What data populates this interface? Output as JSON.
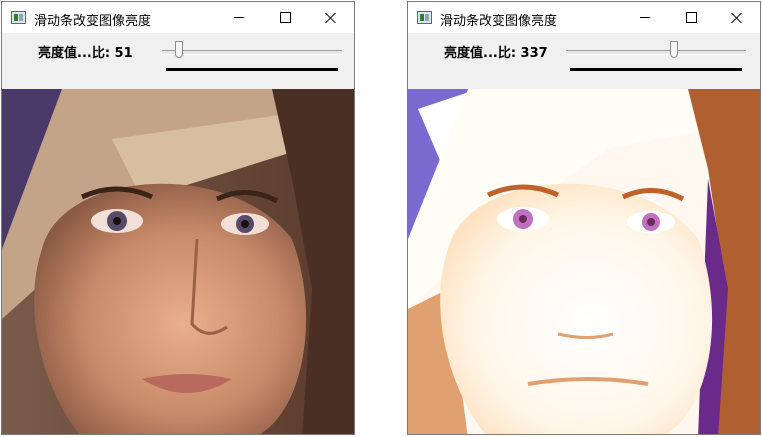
{
  "windows": [
    {
      "title": "滑动条改变图像亮度",
      "trackbar_label": "亮度值...比: 51",
      "trackbar_value": 51
    },
    {
      "title": "滑动条改变图像亮度",
      "trackbar_label": "亮度值...比: 337",
      "trackbar_value": 337
    }
  ],
  "icons": {
    "app": "app-window-icon",
    "minimize": "minimize-icon",
    "maximize": "maximize-icon",
    "close": "close-icon"
  },
  "colors": {
    "title_bar": "#ffffff",
    "window_bg": "#f0f0f0",
    "border": "#7a7a7a"
  }
}
